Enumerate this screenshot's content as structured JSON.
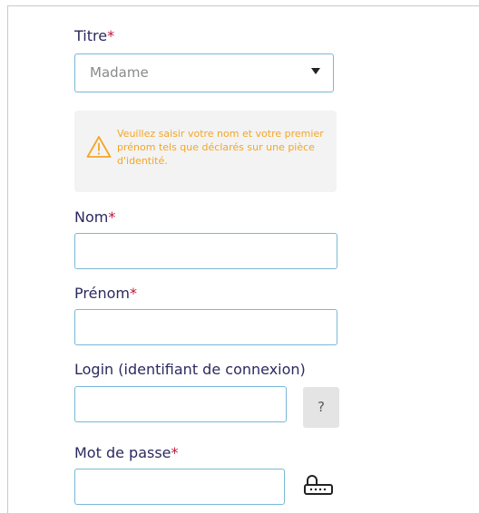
{
  "form": {
    "required_mark": "*",
    "titre": {
      "label": "Titre",
      "selected": "Madame"
    },
    "notice": {
      "text": "Veuillez saisir votre nom et votre premier prénom tels que déclarés sur une pièce d'identité.",
      "color": "#f4a623"
    },
    "nom": {
      "label": "Nom",
      "value": ""
    },
    "prenom": {
      "label": "Prénom",
      "value": ""
    },
    "login": {
      "label": "Login (identifiant de connexion)",
      "value": "",
      "help_label": "?"
    },
    "password": {
      "label": "Mot de passe",
      "value": "",
      "keyboard_icon": "virtual-keyboard-icon"
    }
  },
  "colors": {
    "label": "#2b2a5e",
    "required": "#c0143c",
    "field_border": "#79b8d6"
  }
}
